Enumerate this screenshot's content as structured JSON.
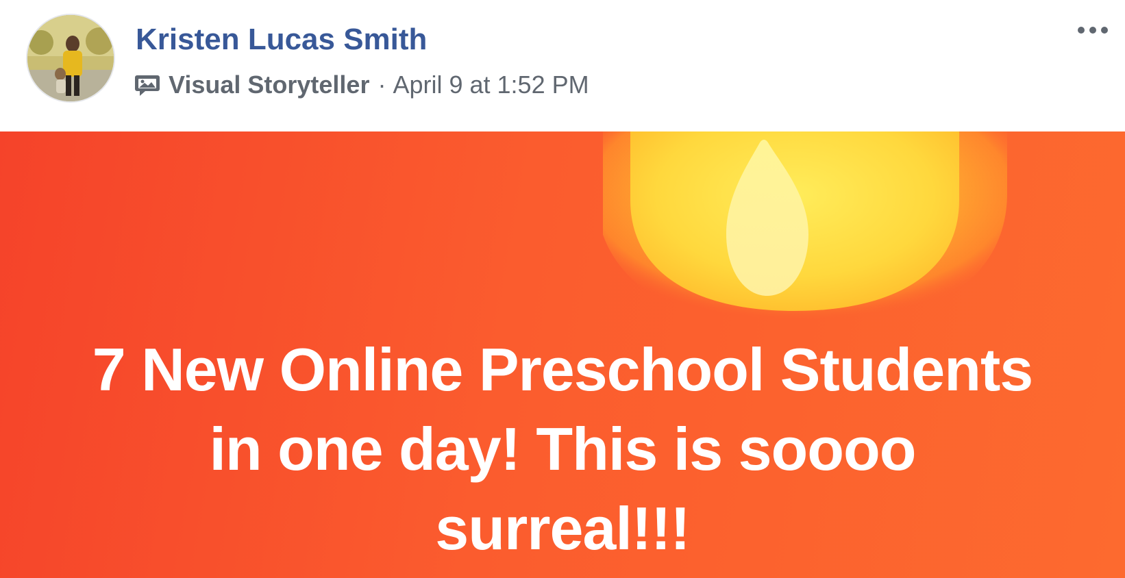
{
  "author": {
    "name": "Kristen Lucas Smith"
  },
  "meta": {
    "badge_icon": "visual-storyteller-icon",
    "badge_label": "Visual Storyteller",
    "separator": "·",
    "timestamp": "April 9 at 1:52 PM"
  },
  "menu": {
    "icon": "more-options-icon"
  },
  "post": {
    "text": "7 New Online Preschool Students in one day! This is soooo surreal!!!",
    "background_colors": [
      "#f5432a",
      "#fd6a2f"
    ],
    "text_color": "#ffffff"
  },
  "colors": {
    "name": "#385898",
    "meta": "#606770"
  }
}
